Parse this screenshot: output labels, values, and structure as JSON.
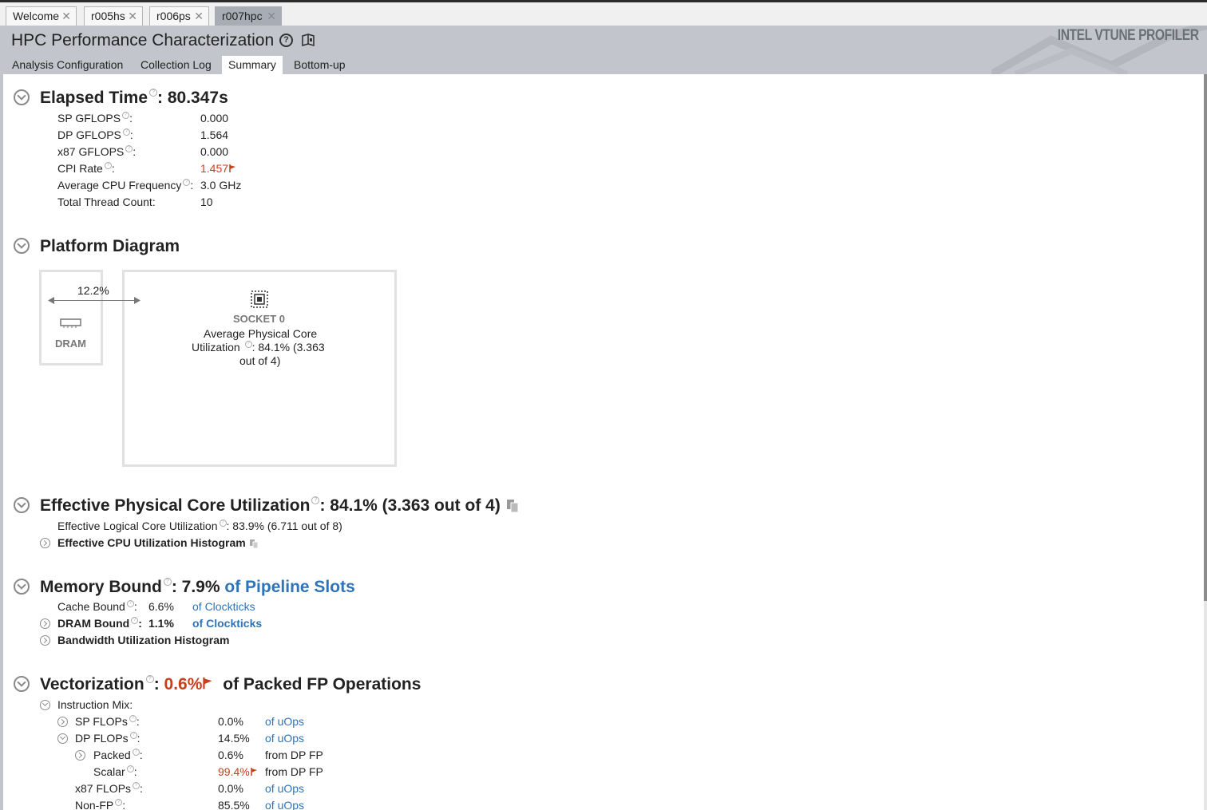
{
  "tabs": [
    {
      "label": "Welcome"
    },
    {
      "label": "r005hs"
    },
    {
      "label": "r006ps"
    },
    {
      "label": "r007hpc"
    }
  ],
  "header": {
    "title": "HPC Performance Characterization",
    "brand": "INTEL VTUNE PROFILER",
    "view_tabs": [
      "Analysis Configuration",
      "Collection Log",
      "Summary",
      "Bottom-up"
    ],
    "active_view_tab": "Summary"
  },
  "elapsed": {
    "title": "Elapsed Time",
    "value": ": 80.347s",
    "metrics": [
      {
        "label": "SP GFLOPS",
        "value": "0.000"
      },
      {
        "label": "DP GFLOPS",
        "value": "1.564"
      },
      {
        "label": "x87 GFLOPS",
        "value": "0.000"
      },
      {
        "label": "CPI Rate",
        "value": "1.457"
      },
      {
        "label": "Average CPU Frequency",
        "value": "3.0 GHz"
      },
      {
        "label": "Total Thread Count:",
        "value": "10"
      }
    ]
  },
  "platform": {
    "title": "Platform Diagram",
    "bandwidth": "12.2%",
    "dram_label": "DRAM",
    "socket_label": "SOCKET 0",
    "socket_text_1": "Average Physical Core",
    "socket_text_2a": "Utilization",
    "socket_text_2b": ": 84.1% (3.363",
    "socket_text_3": "out of 4)"
  },
  "core_util": {
    "title": "Effective Physical Core Utilization",
    "value": ": 84.1% (3.363 out of 4)",
    "logical_label": "Effective Logical Core Utilization",
    "logical_value": ": 83.9% (6.711 out of 8)",
    "histogram": "Effective CPU Utilization Histogram"
  },
  "memory": {
    "title": "Memory Bound",
    "value": ": 7.9%",
    "unit": "of Pipeline Slots",
    "cache_label": "Cache Bound",
    "cache_value": "6.6%",
    "cache_unit": "of Clockticks",
    "dram_label": "DRAM Bound",
    "dram_value": "1.1%",
    "dram_unit": "of Clockticks",
    "histogram": "Bandwidth Utilization Histogram"
  },
  "vectorization": {
    "title": "Vectorization",
    "value": "0.6%",
    "unit": "of Packed FP Operations",
    "mix_label": "Instruction Mix:",
    "rows": [
      {
        "label": "SP FLOPs",
        "value": "0.0%",
        "unit": "of uOps"
      },
      {
        "label": "DP FLOPs",
        "value": "14.5%",
        "unit": "of uOps"
      },
      {
        "label": "Packed",
        "value": "0.6%",
        "unit": "from DP FP"
      },
      {
        "label": "Scalar",
        "value": "99.4%",
        "unit": "from DP FP"
      },
      {
        "label": "x87 FLOPs",
        "value": "0.0%",
        "unit": "of uOps"
      },
      {
        "label": "Non-FP",
        "value": "85.5%",
        "unit": "of uOps"
      }
    ]
  },
  "colors": {
    "flag": "#c8401a",
    "link": "#2f73b8",
    "header": "#c2c6cc"
  }
}
